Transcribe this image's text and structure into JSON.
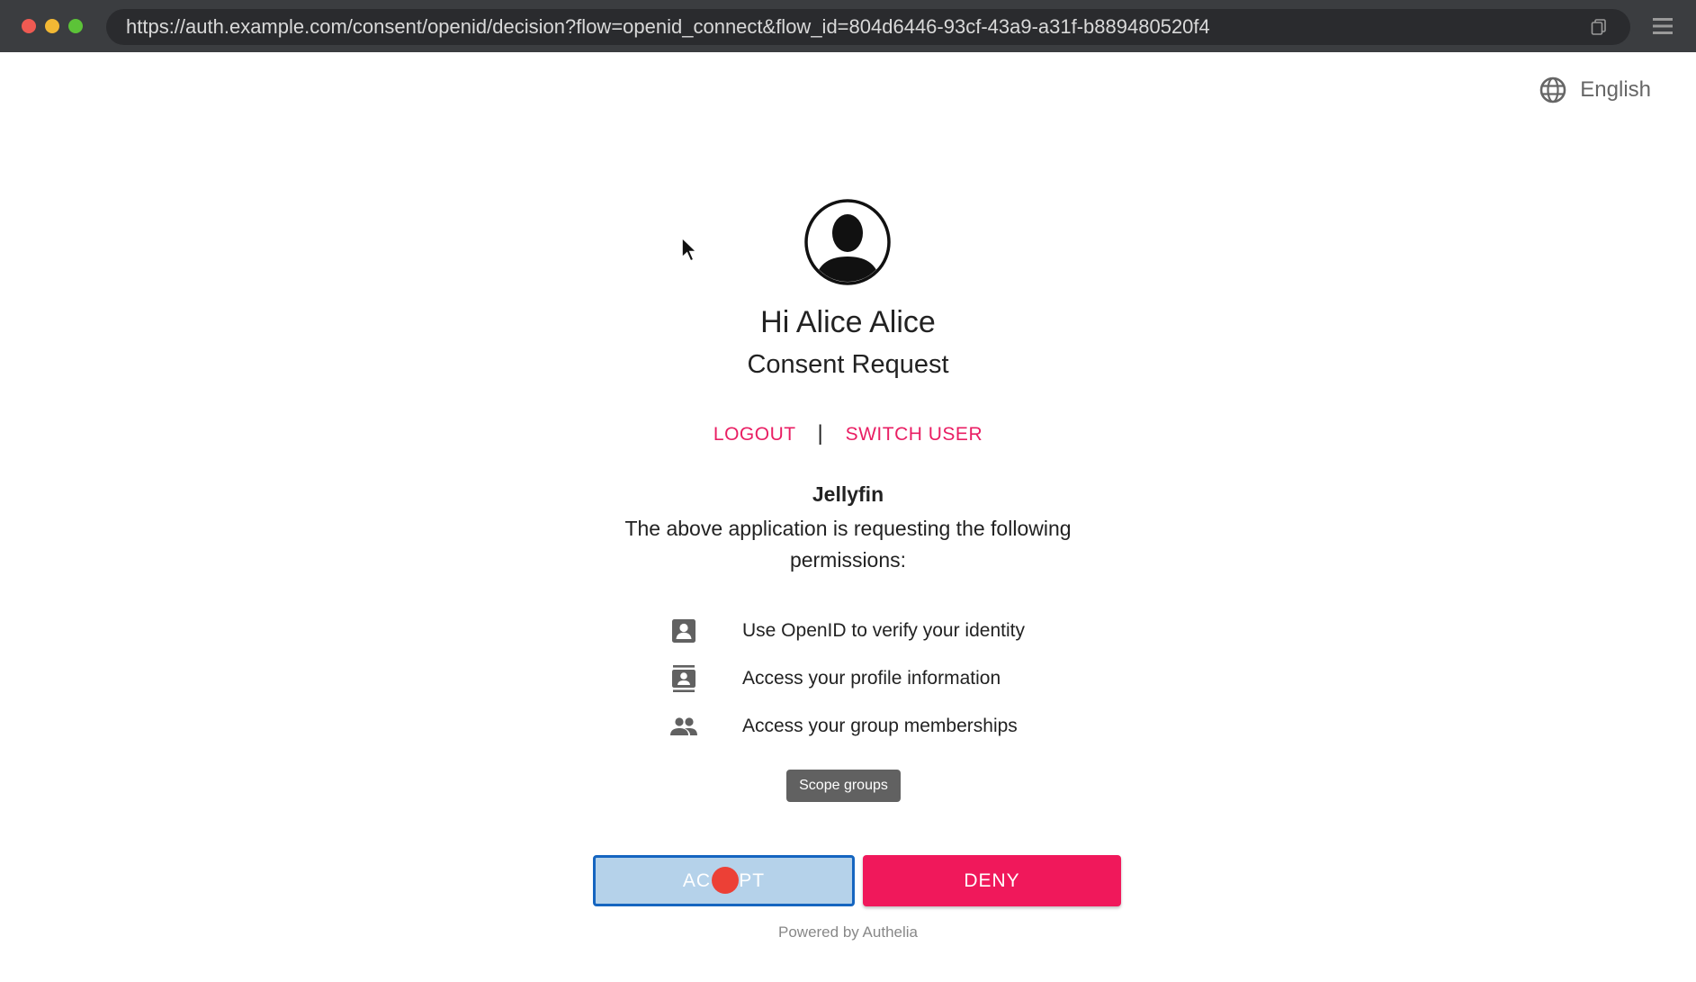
{
  "browser": {
    "url": "https://auth.example.com/consent/openid/decision?flow=openid_connect&flow_id=804d6446-93cf-43a9-a31f-b889480520f4"
  },
  "language": {
    "label": "English"
  },
  "header": {
    "greeting": "Hi Alice Alice",
    "subtitle": "Consent Request"
  },
  "links": {
    "logout": "LOGOUT",
    "separator": "|",
    "switch_user": "SWITCH USER"
  },
  "client": {
    "name": "Jellyfin",
    "request_text": "The above application is requesting the following permissions:"
  },
  "permissions": [
    {
      "icon": "badge-icon",
      "label": "Use OpenID to verify your identity"
    },
    {
      "icon": "contacts-icon",
      "label": "Access your profile information"
    },
    {
      "icon": "group-icon",
      "label": "Access your group memberships"
    }
  ],
  "tooltip": {
    "text": "Scope groups"
  },
  "buttons": {
    "accept": "ACCEPT",
    "deny": "DENY"
  },
  "footer": {
    "powered_by": "Powered by Authelia"
  },
  "colors": {
    "accent": "#e91e63",
    "accept_border": "#1565c0",
    "deny_bg": "#f0185b",
    "click_indicator": "#ec4036"
  }
}
